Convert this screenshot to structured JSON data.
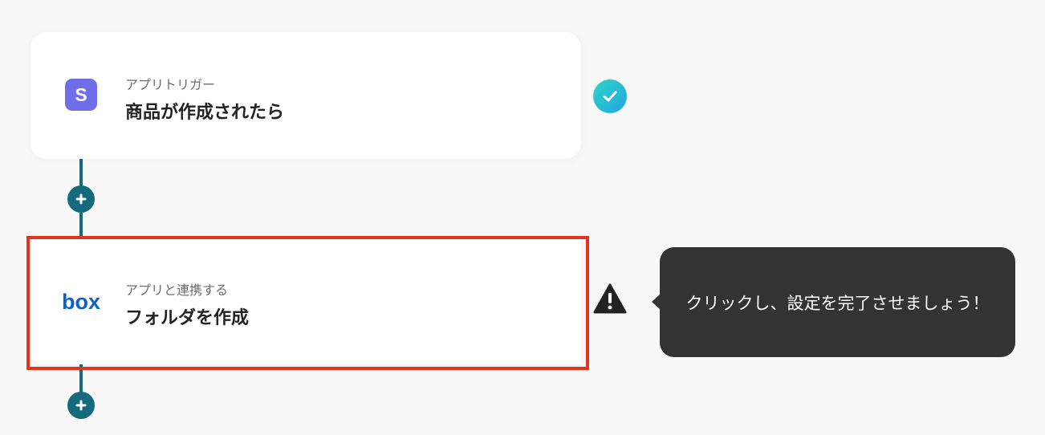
{
  "steps": [
    {
      "label": "アプリトリガー",
      "title": "商品が作成されたら",
      "icon": "stripe-logo-icon",
      "icon_text": "S",
      "icon_color": "#6f6ee8",
      "status": "check-icon"
    },
    {
      "label": "アプリと連携する",
      "title": "フォルダを作成",
      "icon": "box-logo-icon",
      "icon_text": "box",
      "icon_color": "#0c61c4",
      "status": "warning-icon"
    }
  ],
  "tooltip": {
    "text": "クリックし、設定を完了させましょう！"
  },
  "colors": {
    "connector": "#156a7e",
    "highlight": "#e8321e",
    "tooltip_bg": "#333333"
  }
}
